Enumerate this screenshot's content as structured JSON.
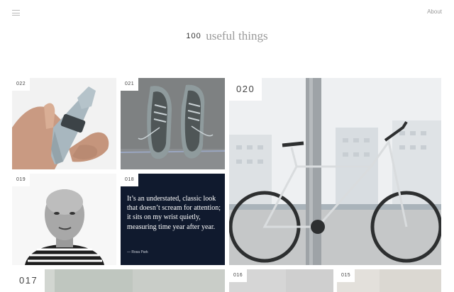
{
  "header": {
    "menu_icon": "hamburger-menu-icon",
    "about_label": "About",
    "title_number": "100",
    "title_text": "useful things"
  },
  "tiles": [
    {
      "number": "022",
      "subject": "adjustable wrench held in hand"
    },
    {
      "number": "021",
      "subject": "pair of canvas sneakers"
    },
    {
      "number": "020",
      "subject": "white city bicycle"
    },
    {
      "number": "019",
      "subject": "portrait of man in striped shirt"
    },
    {
      "number": "018",
      "quote": "It’s an understated, classic look that doesn’t scream for attention; it sits on my wrist quietly, measuring time year after year.",
      "quote_author": "— Rosa Park"
    },
    {
      "number": "017"
    },
    {
      "number": "016"
    },
    {
      "number": "015"
    }
  ],
  "colors": {
    "quote_background": "#101a2e",
    "label_background": "#ffffff",
    "title_grey": "#9a9a9a"
  }
}
